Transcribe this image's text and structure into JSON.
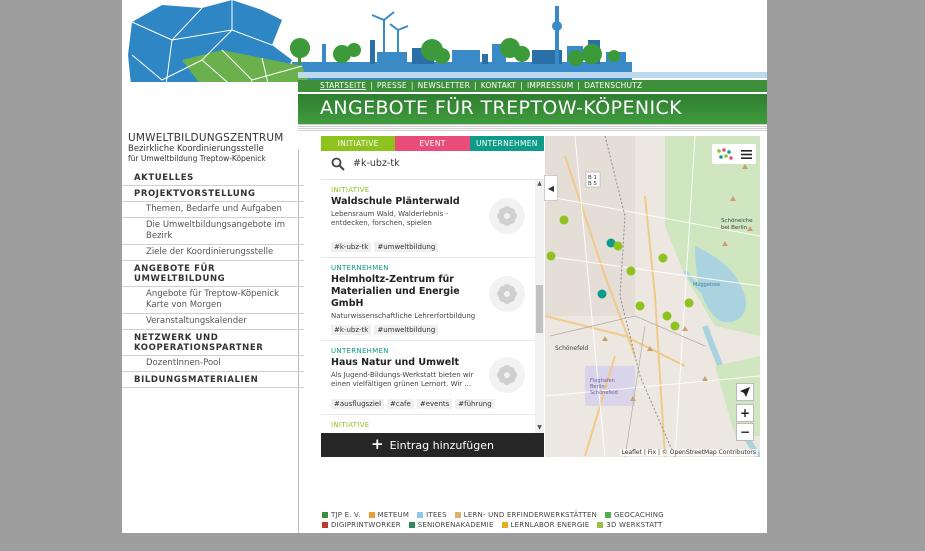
{
  "colors": {
    "header_green": "#3d8f3a",
    "tab_initiative": "#8dc21f",
    "tab_event": "#e84d7a",
    "tab_unternehmen": "#0e9b8a",
    "button_dark": "#262626"
  },
  "header": {
    "nav": [
      "STARTSEITE",
      "PRESSE",
      "NEWSLETTER",
      "KONTAKT",
      "IMPRESSUM",
      "DATENSCHUTZ"
    ],
    "title": "ANGEBOTE FÜR TREPTOW-KÖPENICK"
  },
  "logo": {
    "line1": "UMWELTBILDUNGSZENTRUM",
    "line2": "Bezirkliche Koordinierungsstelle",
    "line3": "für Umweltbildung Treptow-Köpenick"
  },
  "sidebar": {
    "aktuelles": "AKTUELLES",
    "projektvorstellung": "PROJEKTVORSTELLUNG",
    "sub_themen": "Themen, Bedarfe und Aufgaben",
    "sub_angebote": "Die Umweltbildungsangebote im Bezirk",
    "sub_ziele": "Ziele der Koordinierungsstelle",
    "angebote": "ANGEBOTE FÜR UMWELTBILDUNG",
    "sub_karte": "Angebote für Treptow-Köpenick Karte von Morgen",
    "sub_kalender": "Veranstaltungskalender",
    "netzwerk": "NETZWERK UND KOOPERATIONSPARTNER",
    "sub_pool": "DozentInnen-Pool",
    "materialien": "BILDUNGSMATERIALIEN"
  },
  "widget": {
    "tabs": [
      "INITIATIVE",
      "EVENT",
      "UNTERNEHMEN"
    ],
    "search_value": "#k-ubz-tk",
    "entries": [
      {
        "type": "INITIATIVE",
        "name": "Waldschule Plänterwald",
        "desc": "Lebensraum Wald, Walderlebnis - entdecken, forschen, spielen",
        "tags": [
          "#k-ubz-tk",
          "#umweltbildung"
        ]
      },
      {
        "type": "UNTERNEHMEN",
        "name": "Helmholtz-Zentrum für Materialien und Energie GmbH",
        "desc": "Naturwissenschaftliche Lehrerfortbildung",
        "tags": [
          "#k-ubz-tk",
          "#umweltbildung"
        ]
      },
      {
        "type": "UNTERNEHMEN",
        "name": "Haus Natur und Umwelt",
        "desc": "Als Jugend-Bildungs-Werkstatt bieten wir einen vielfältigen grünen Lernort. Wir ...",
        "tags": [
          "#ausflugsziel",
          "#cafe",
          "#events",
          "#führung"
        ]
      },
      {
        "type": "INITIATIVE",
        "name": "",
        "desc": "",
        "tags": []
      }
    ],
    "add_label": "Eintrag hinzufügen"
  },
  "map": {
    "labels": {
      "schoeneiche": "Schöneiche bei Berlin",
      "schoenefeld": "Schönefeld",
      "flughafen": "Flughafen Berlin-Schönefeld",
      "mueggelsee": "Müggelsee",
      "b1b5": "B 1\nB 5"
    },
    "attribution": "Leaflet | Fix | © OpenStreetMap Contributors"
  },
  "legend": {
    "row1": [
      {
        "label": "TJP E. V.",
        "color": "#3d8f3a"
      },
      {
        "label": "METEUM",
        "color": "#f29c38"
      },
      {
        "label": "ITEES",
        "color": "#8cc7e8"
      },
      {
        "label": "LERN- UND ERFINDERWERKSTÄTTEN",
        "color": "#d9b36b"
      },
      {
        "label": "GEOCACHING",
        "color": "#4caf50"
      }
    ],
    "row2": [
      {
        "label": "DIGIPRINTWORKER",
        "color": "#c0392b"
      },
      {
        "label": "SENIORENAKADEMIE",
        "color": "#2e8b57"
      },
      {
        "label": "LERNLABOR ENERGIE",
        "color": "#e0b020"
      },
      {
        "label": "3D WERKSTATT",
        "color": "#9cbf4a"
      }
    ]
  }
}
